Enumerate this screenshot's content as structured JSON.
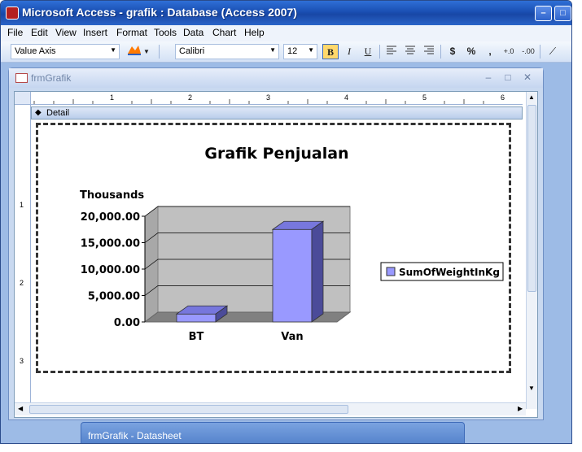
{
  "window": {
    "title": "Microsoft Access - grafik : Database (Access 2007)",
    "min_glyph": "–",
    "max_glyph": "□",
    "close_glyph": "✕"
  },
  "menu": [
    "File",
    "Edit",
    "View",
    "Insert",
    "Format",
    "Tools",
    "Data",
    "Chart",
    "Help"
  ],
  "toolbar": {
    "object_selector": "Value Axis",
    "font_name": "Calibri",
    "font_size": "12",
    "bold": "B",
    "italic": "I",
    "underline": "U",
    "currency": "$",
    "percent": "%",
    "comma": ",",
    "inc_decimal": "+.0",
    "dec_decimal": "-.00"
  },
  "child_window": {
    "title": "frmGrafik",
    "min_glyph": "–",
    "max_glyph": "□",
    "close_glyph": "✕"
  },
  "design": {
    "section": "Detail",
    "ruler_h": [
      "1",
      "2",
      "3",
      "4",
      "5",
      "6"
    ],
    "ruler_v": [
      "1",
      "2",
      "3"
    ]
  },
  "chart_data": {
    "type": "bar",
    "title": "Grafik Penjualan",
    "ylabel": "Thousands",
    "categories": [
      "BT",
      "Van"
    ],
    "series": [
      {
        "name": "SumOfWeightInKg",
        "values": [
          1500,
          17500
        ]
      }
    ],
    "y_ticks": [
      "20,000.00",
      "15,000.00",
      "10,000.00",
      "5,000.00",
      "0.00"
    ],
    "ylim": [
      0,
      20000
    ],
    "grid": true,
    "legend": "right",
    "bar_color": "#9999ff",
    "wall_color": "#c0c0c0"
  },
  "taskbar": {
    "item": "frmGrafik - Datasheet"
  }
}
